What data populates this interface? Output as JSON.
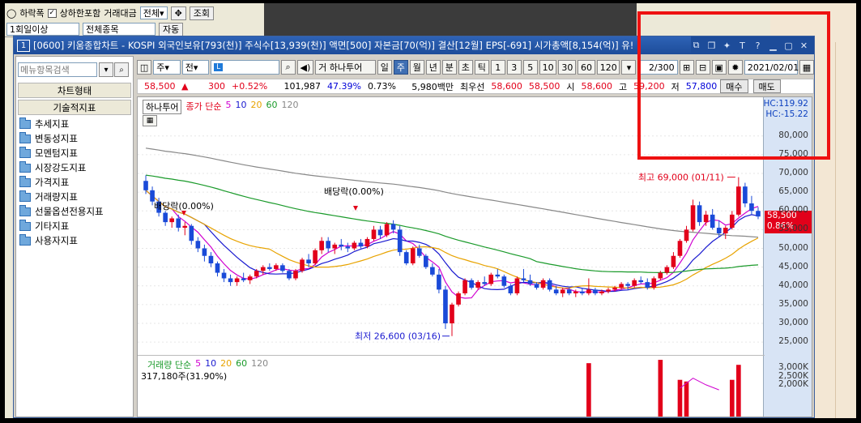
{
  "background_app": {
    "row1": [
      "하락폭",
      "상하한포함",
      "거래대금",
      "전체",
      "조회"
    ],
    "row2": [
      "1회일이상",
      "전체종목",
      "자동"
    ]
  },
  "window": {
    "num": "1",
    "title": "[0600] 키움종합차트 - KOSPI 외국인보유[793(천)] 주식수[13,939(천)] 액면[500] 자본금[70(억)] 결산[12월] EPS[-691] 시가총액[8,154(억)] 유!"
  },
  "left_panel": {
    "search_placeholder": "메뉴항목검색",
    "chart_type_label": "차트형태",
    "indicator_label": "기술적지표",
    "items": [
      "추세지표",
      "변동성지표",
      "모멘텀지표",
      "시장강도지표",
      "가격지표",
      "거래량지표",
      "선물옵션전용지표",
      "기타지표",
      "사용자지표"
    ]
  },
  "toolbar": {
    "unit1": "주",
    "unit2": "전",
    "broker": "하나투어",
    "broker_prefix": "거",
    "periods": [
      "일",
      "주",
      "월",
      "년",
      "분",
      "초",
      "틱"
    ],
    "selected_period": "주",
    "numbers": [
      "1",
      "3",
      "5",
      "10",
      "30",
      "60",
      "120"
    ],
    "count": "2/300",
    "date": "2021/02/01"
  },
  "quote": {
    "price": "58,500",
    "change": "300",
    "pct": "+0.52%",
    "volume": "101,987",
    "vol_pct": "47.39%",
    "turnover": "0.73%",
    "amount": "5,980백만",
    "best_label": "최우선",
    "ask": "58,600",
    "bid": "58,500",
    "open_label": "시",
    "open": "58,600",
    "high_label": "고",
    "high": "59,200",
    "low_label": "저",
    "low": "57,800",
    "buy": "매수",
    "sell": "매도"
  },
  "chart_labels": {
    "name": "하나투어",
    "ma_title": "종가 단순",
    "ma_periods": [
      "5",
      "10",
      "20",
      "60",
      "120"
    ],
    "ma_colors": [
      "#d000d0",
      "#1a1ad0",
      "#e8a300",
      "#1a9a2a",
      "#888888"
    ],
    "dividend1": "배당락(0.00%)",
    "dividend2": "배당락(0.00%)",
    "max_label": "최고 69,000 (01/11)",
    "min_label": "최저 26,600 (03/16)",
    "hc_top": "HC:119.92",
    "hc_bot": "HC:-15.22",
    "cur_price": "58,500",
    "cur_pct": "0.86%",
    "vol_title": "거래량 단순",
    "vol_periods": [
      "5",
      "10",
      "20",
      "60",
      "120"
    ],
    "vol_value": "317,180주(31.90%)"
  },
  "chart_data": {
    "type": "candlestick",
    "y_ticks": [
      "80,000",
      "75,000",
      "70,000",
      "65,000",
      "60,000",
      "55,000",
      "50,000",
      "45,000",
      "40,000",
      "35,000",
      "30,000",
      "25,000"
    ],
    "ylim": [
      22000,
      86000
    ],
    "vol_ticks": [
      "3,000K",
      "2,500K",
      "2,000K"
    ],
    "candles": [
      [
        68000,
        69500,
        64500,
        65500
      ],
      [
        65500,
        66500,
        61500,
        62500
      ],
      [
        62500,
        63500,
        58500,
        59500
      ],
      [
        59500,
        60000,
        56000,
        57000
      ],
      [
        57000,
        58500,
        55500,
        58000
      ],
      [
        58000,
        59000,
        54500,
        55500
      ],
      [
        55500,
        57000,
        53500,
        56000
      ],
      [
        56000,
        56500,
        51000,
        52000
      ],
      [
        52000,
        53000,
        49000,
        50000
      ],
      [
        50000,
        51000,
        46500,
        48000
      ],
      [
        48000,
        49000,
        45000,
        46000
      ],
      [
        46000,
        46500,
        42500,
        43500
      ],
      [
        43500,
        44500,
        41000,
        42000
      ],
      [
        42000,
        43000,
        40000,
        41000
      ],
      [
        41000,
        42500,
        40000,
        42000
      ],
      [
        42000,
        43500,
        41000,
        41500
      ],
      [
        41500,
        43000,
        40500,
        42500
      ],
      [
        42500,
        44500,
        42000,
        44000
      ],
      [
        44000,
        45500,
        43000,
        45000
      ],
      [
        45000,
        46000,
        44000,
        44500
      ],
      [
        44500,
        46000,
        44000,
        45500
      ],
      [
        45500,
        46000,
        43500,
        44000
      ],
      [
        44000,
        44500,
        41500,
        42000
      ],
      [
        42000,
        44500,
        41500,
        44000
      ],
      [
        44000,
        47500,
        43500,
        47000
      ],
      [
        47000,
        48500,
        45000,
        46000
      ],
      [
        46000,
        50000,
        45500,
        49500
      ],
      [
        49500,
        53000,
        48500,
        52000
      ],
      [
        52000,
        53000,
        49000,
        50000
      ],
      [
        50000,
        51500,
        48500,
        51000
      ],
      [
        51000,
        52500,
        49500,
        50500
      ],
      [
        50500,
        51500,
        49000,
        50000
      ],
      [
        50000,
        52000,
        49500,
        51500
      ],
      [
        51500,
        52500,
        50000,
        50500
      ],
      [
        50500,
        53000,
        50000,
        52500
      ],
      [
        52500,
        56000,
        52000,
        55000
      ],
      [
        55000,
        56000,
        52500,
        53500
      ],
      [
        53500,
        57000,
        53000,
        56500
      ],
      [
        56500,
        57500,
        54000,
        55000
      ],
      [
        55000,
        56000,
        48000,
        49000
      ],
      [
        49000,
        49500,
        45500,
        46000
      ],
      [
        46000,
        50500,
        45500,
        50000
      ],
      [
        50000,
        51000,
        47500,
        48000
      ],
      [
        48000,
        48500,
        44500,
        45000
      ],
      [
        45000,
        46000,
        42500,
        43000
      ],
      [
        43000,
        44500,
        38000,
        39000
      ],
      [
        39000,
        40000,
        28500,
        30000
      ],
      [
        30000,
        35500,
        26600,
        35000
      ],
      [
        35000,
        38500,
        34500,
        38000
      ],
      [
        38000,
        42000,
        37500,
        41500
      ],
      [
        41500,
        42000,
        39000,
        39500
      ],
      [
        39500,
        41500,
        39000,
        41000
      ],
      [
        41000,
        42500,
        40000,
        40500
      ],
      [
        40500,
        43500,
        40000,
        43000
      ],
      [
        43000,
        44500,
        42000,
        42500
      ],
      [
        42500,
        43000,
        39500,
        40000
      ],
      [
        40000,
        40500,
        37500,
        38000
      ],
      [
        38000,
        42500,
        37500,
        42000
      ],
      [
        42000,
        44500,
        41000,
        41500
      ],
      [
        41500,
        43000,
        40000,
        40500
      ],
      [
        40500,
        41000,
        39000,
        39500
      ],
      [
        39500,
        42000,
        39000,
        41500
      ],
      [
        41500,
        42000,
        38500,
        39000
      ],
      [
        39000,
        40000,
        37500,
        38000
      ],
      [
        38000,
        39500,
        37000,
        39000
      ],
      [
        39000,
        39500,
        37500,
        38000
      ],
      [
        38000,
        39000,
        37000,
        38500
      ],
      [
        38500,
        39500,
        37500,
        38000
      ],
      [
        38000,
        42000,
        37500,
        39000
      ],
      [
        39000,
        39500,
        37500,
        38000
      ],
      [
        38000,
        39000,
        37500,
        38500
      ],
      [
        38500,
        39500,
        38000,
        39000
      ],
      [
        39000,
        40000,
        38500,
        39500
      ],
      [
        39500,
        41000,
        39000,
        40500
      ],
      [
        40500,
        41000,
        39000,
        40000
      ],
      [
        40000,
        42000,
        39500,
        41500
      ],
      [
        41500,
        42500,
        40500,
        41000
      ],
      [
        41000,
        42000,
        39000,
        39500
      ],
      [
        39500,
        42500,
        39000,
        42000
      ],
      [
        42000,
        44000,
        41500,
        43500
      ],
      [
        43500,
        45500,
        43000,
        45000
      ],
      [
        45000,
        49000,
        44500,
        48000
      ],
      [
        48000,
        52500,
        47500,
        52000
      ],
      [
        52000,
        56000,
        51500,
        55000
      ],
      [
        55000,
        63000,
        54500,
        61500
      ],
      [
        61500,
        62500,
        56000,
        57000
      ],
      [
        57000,
        60000,
        56000,
        59000
      ],
      [
        59000,
        60500,
        55000,
        55500
      ],
      [
        55500,
        57500,
        53000,
        54000
      ],
      [
        54000,
        56000,
        52500,
        55500
      ],
      [
        55500,
        60000,
        55000,
        59000
      ],
      [
        59000,
        69000,
        58500,
        66500
      ],
      [
        66500,
        67500,
        61000,
        62000
      ],
      [
        62000,
        64000,
        59000,
        60000
      ],
      [
        60000,
        61000,
        57800,
        58500
      ]
    ],
    "volume": [
      0,
      0,
      0,
      0,
      0,
      0,
      0,
      0,
      0,
      0,
      0,
      0,
      0,
      0,
      0,
      0,
      0,
      0,
      0,
      0,
      0,
      0,
      0,
      0,
      0,
      0,
      0,
      0,
      0,
      0,
      0,
      0,
      0,
      0,
      0,
      0,
      0,
      0,
      0,
      0,
      0,
      0,
      0,
      0,
      0,
      0,
      0,
      0,
      0,
      0,
      0,
      0,
      0,
      0,
      0,
      0,
      0,
      0,
      0,
      0,
      0,
      0,
      0,
      0,
      0,
      0,
      0,
      0,
      3300000,
      0,
      0,
      0,
      0,
      0,
      0,
      0,
      0,
      0,
      0,
      3500000,
      0,
      0,
      2300000,
      2200000,
      0,
      0,
      0,
      0,
      0,
      0,
      2300000,
      3200000,
      0,
      0,
      0
    ]
  }
}
